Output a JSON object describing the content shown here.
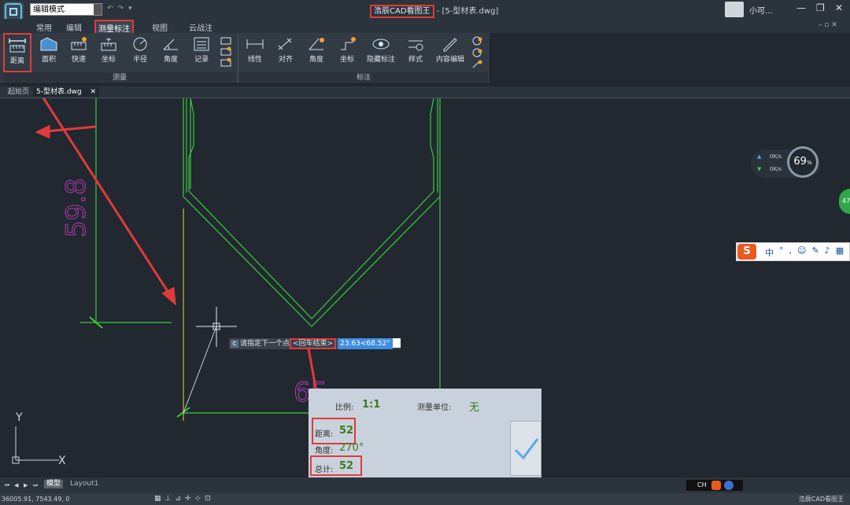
{
  "window": {
    "mode_select": "编辑模式",
    "app_name": "浩辰CAD看图王",
    "doc_suffix": "- [5-型材表.dwg]",
    "user_name": "小可..."
  },
  "menu": {
    "tabs": [
      "常用",
      "编辑",
      "测量标注",
      "视图",
      "云战注"
    ]
  },
  "ribbon": {
    "measure_group": "测量",
    "annotate_group": "标注",
    "measure_buttons": [
      "距离",
      "面积",
      "快速",
      "坐标",
      "半径",
      "角度",
      "记录"
    ],
    "annotate_buttons": [
      "线性",
      "对齐",
      "角度",
      "坐标",
      "隐藏标注",
      "样式",
      "内容编辑"
    ]
  },
  "doc_tabs": {
    "start": "起始页",
    "file": "5-型材表.dwg"
  },
  "drawing": {
    "dim_vertical": "59.8",
    "dim_bottom": "65",
    "axis_x": "X",
    "axis_y": "Y"
  },
  "prompt": {
    "text": "请指定下一个点",
    "hint": "<回车结束>",
    "input": "23.63<68.52°"
  },
  "panel": {
    "scale_label": "比例:",
    "scale_value": "1:1",
    "unit_label": "测量单位:",
    "unit_value": "无",
    "distance_label": "距离:",
    "distance_value": "52",
    "angle_label": "角度:",
    "angle_value": "270°",
    "total_label": "总计:",
    "total_value": "52"
  },
  "speed": {
    "up": "0K/s",
    "down": "0K/s",
    "percent": "69",
    "percent_unit": "%"
  },
  "side_tab": "47",
  "ime": {
    "logo": "S",
    "mode": "中"
  },
  "layout_tabs": {
    "model": "模型",
    "layout1": "Layout1"
  },
  "system_tray": {
    "lang": "CH"
  },
  "status": {
    "coords": "36005.91, 7543.49, 0",
    "brand": "浩辰CAD看图王"
  },
  "colors": {
    "background": "#212830",
    "cad_green": "#3ec83e",
    "cad_magenta": "#b43ab4",
    "cad_yellow": "#c8b43a",
    "annotation_red": "#e23a3a"
  }
}
